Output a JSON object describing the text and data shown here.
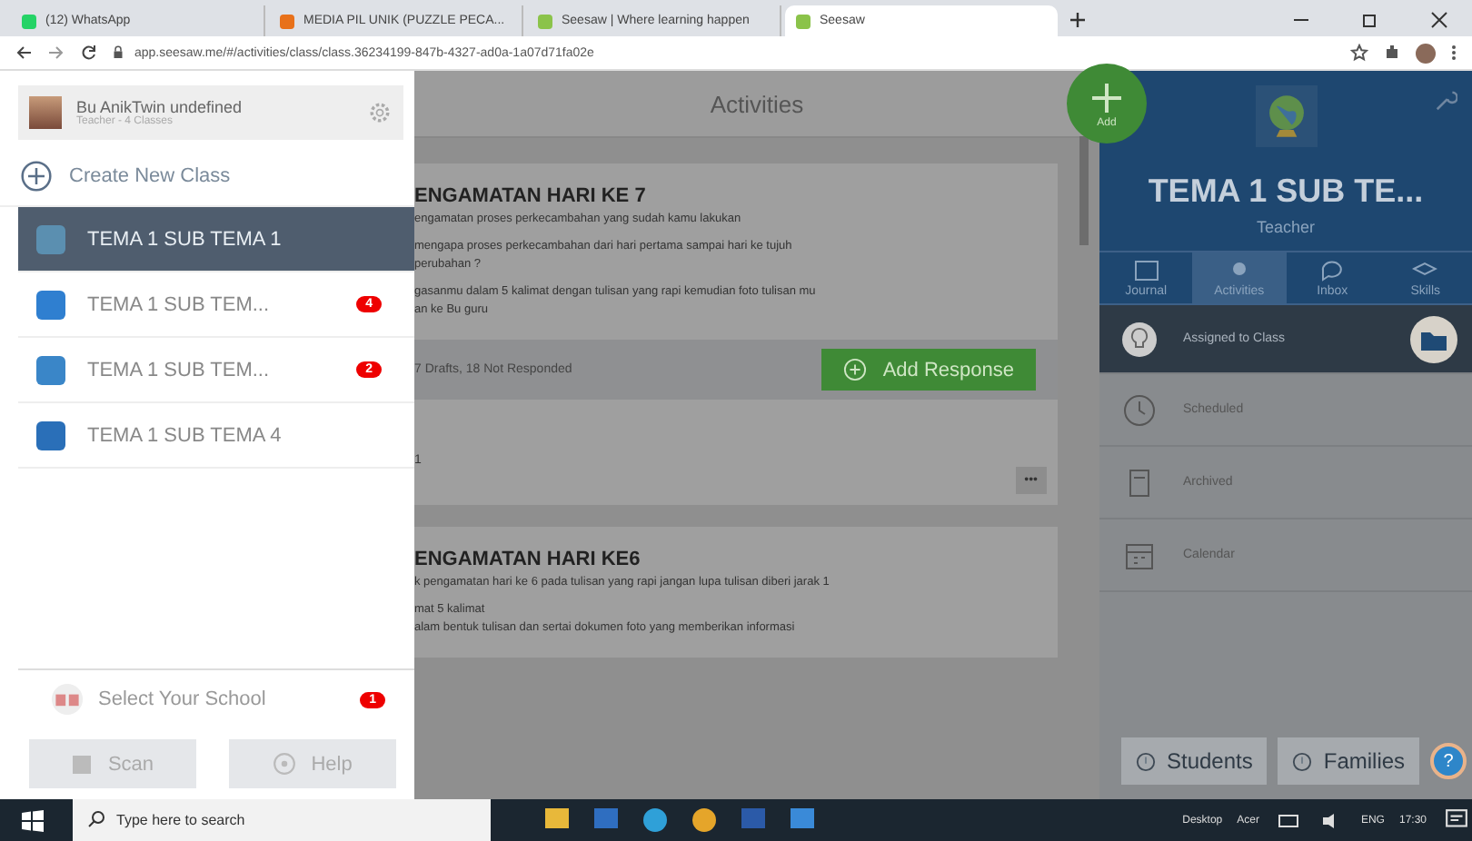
{
  "browser": {
    "tabs": [
      {
        "title": "(12) WhatsApp",
        "color": "#25d366",
        "selected": false
      },
      {
        "title": "MEDIA PIL UNIK (PUZZLE PECA...",
        "color": "#e8711a",
        "selected": false
      },
      {
        "title": "Seesaw | Where learning happen",
        "color": "#8bc34a",
        "selected": false
      },
      {
        "title": "Seesaw",
        "color": "#8bc34a",
        "selected": true
      }
    ],
    "url": "app.seesaw.me/#/activities/class/class.36234199-847b-4327-ad0a-1a07d71fa02e"
  },
  "drawer": {
    "user": {
      "name": "Bu AnikTwin undefined",
      "role": "Teacher - 4 Classes"
    },
    "create_label": "Create New Class",
    "classes": [
      {
        "name": "TEMA 1 SUB TEMA 1",
        "color": "#5b8fb0",
        "selected": true
      },
      {
        "name": "TEMA 1 SUB TEM...",
        "color": "#2f7fd0",
        "badge": "4",
        "selected": false
      },
      {
        "name": "TEMA 1 SUB TEM...",
        "color": "#3a86c8",
        "badge": "2",
        "selected": false
      },
      {
        "name": "TEMA 1 SUB TEMA 4",
        "color": "#2a6fb8",
        "selected": false
      }
    ],
    "school": {
      "label": "Select Your School",
      "badge": "1"
    },
    "buttons": [
      "Scan",
      "Help"
    ]
  },
  "main": {
    "title": "Activities",
    "cards": [
      {
        "title": "ENGAMATAN HARI KE 7",
        "lines": [
          "engamatan proses perkecambahan yang sudah kamu lakukan",
          "mengapa proses perkecambahan dari hari pertama sampai hari ke tujuh",
          "perubahan ?",
          "gasanmu dalam 5 kalimat dengan tulisan yang rapi kemudian foto tulisan mu",
          "an ke Bu guru"
        ],
        "status": "7 Drafts, 18 Not Responded",
        "action": "Add Response",
        "footer": "1",
        "more": "•••"
      },
      {
        "title": "ENGAMATAN HARI KE6",
        "lines": [
          "k pengamatan hari ke 6 pada tulisan yang rapi jangan lupa tulisan diberi jarak 1",
          "mat 5 kalimat",
          "alam bentuk tulisan dan sertai dokumen foto yang memberikan informasi"
        ]
      }
    ],
    "fab": "Add"
  },
  "class_panel": {
    "title": "TEMA 1 SUB TE...",
    "role": "Teacher",
    "tabs": [
      {
        "label": "Journal",
        "selected": false
      },
      {
        "label": "Activities",
        "selected": true
      },
      {
        "label": "Inbox",
        "selected": false
      },
      {
        "label": "Skills",
        "selected": false
      }
    ],
    "menu": [
      {
        "label": "Assigned to Class",
        "selected": true
      },
      {
        "label": "Scheduled",
        "selected": false
      },
      {
        "label": "Archived",
        "selected": false
      },
      {
        "label": "Calendar",
        "selected": false
      }
    ],
    "buttons": [
      "Students",
      "Families"
    ],
    "help": "?"
  },
  "taskbar": {
    "search_placeholder": "Type here to search",
    "desktop": "Desktop",
    "user": "Acer",
    "language": "ENG",
    "time": "17:30"
  }
}
